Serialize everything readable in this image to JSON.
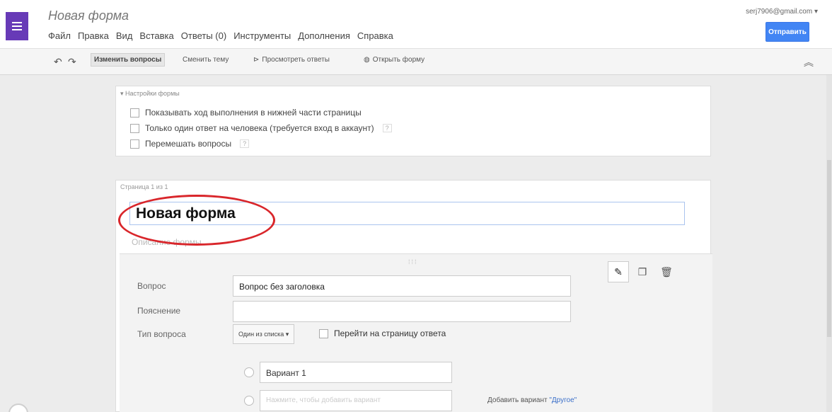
{
  "header": {
    "title": "Новая форма",
    "account": "serj7906@gmail.com ▾",
    "send_label": "Отправить",
    "menu": [
      "Файл",
      "Правка",
      "Вид",
      "Вставка",
      "Ответы (0)",
      "Инструменты",
      "Дополнения",
      "Справка"
    ]
  },
  "toolbar": {
    "edit_questions": "Изменить вопросы",
    "change_theme": "Сменить тему",
    "view_responses": "Просмотреть ответы",
    "open_form": "Открыть форму"
  },
  "settings": {
    "title": "▾ Настройки формы",
    "options": [
      "Показывать ход выполнения в нижней части страницы",
      "Только один ответ на человека (требуется вход в аккаунт)",
      "Перемешать вопросы"
    ]
  },
  "form": {
    "page_tab": "Страница 1 из 1",
    "title": "Новая форма",
    "description_placeholder": "Описание формы"
  },
  "question": {
    "question_label": "Вопрос",
    "question_value": "Вопрос без заголовка",
    "hint_label": "Пояснение",
    "hint_value": "",
    "type_label": "Тип вопроса",
    "type_value": "Один из списка ▾",
    "goto_label": "Перейти на страницу ответа",
    "option1": "Вариант 1",
    "option_placeholder": "Нажмите, чтобы добавить вариант",
    "add_other_prefix": "Добавить вариант ",
    "add_other_link": "\"Другое\""
  },
  "colors": {
    "brand": "#673ab7",
    "send": "#4285f4",
    "annotation": "#d9262b"
  }
}
